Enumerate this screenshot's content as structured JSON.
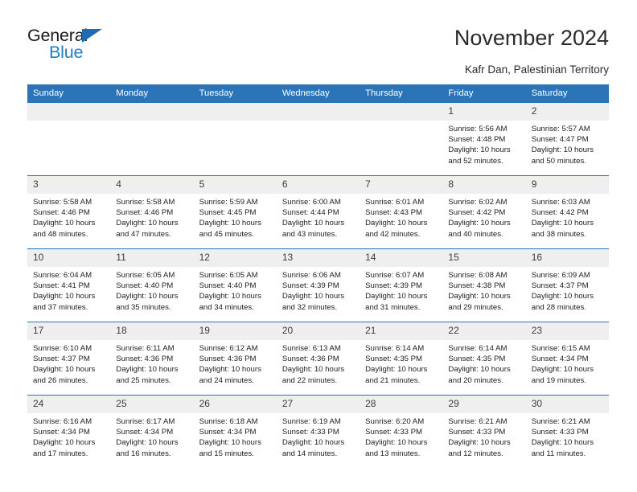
{
  "brand": {
    "name_top": "General",
    "name_bottom": "Blue",
    "accent_color": "#2c74b8"
  },
  "header": {
    "title": "November 2024",
    "subtitle": "Kafr Dan, Palestinian Territory"
  },
  "calendar": {
    "weekday_headers": [
      "Sunday",
      "Monday",
      "Tuesday",
      "Wednesday",
      "Thursday",
      "Friday",
      "Saturday"
    ],
    "labels": {
      "sunrise": "Sunrise:",
      "sunset": "Sunset:",
      "daylight": "Daylight:"
    },
    "weeks": [
      [
        {
          "day": "",
          "empty": true
        },
        {
          "day": "",
          "empty": true
        },
        {
          "day": "",
          "empty": true
        },
        {
          "day": "",
          "empty": true
        },
        {
          "day": "",
          "empty": true
        },
        {
          "day": "1",
          "sunrise": "Sunrise: 5:56 AM",
          "sunset": "Sunset: 4:48 PM",
          "daylight_1": "Daylight: 10 hours",
          "daylight_2": "and 52 minutes."
        },
        {
          "day": "2",
          "sunrise": "Sunrise: 5:57 AM",
          "sunset": "Sunset: 4:47 PM",
          "daylight_1": "Daylight: 10 hours",
          "daylight_2": "and 50 minutes."
        }
      ],
      [
        {
          "day": "3",
          "sunrise": "Sunrise: 5:58 AM",
          "sunset": "Sunset: 4:46 PM",
          "daylight_1": "Daylight: 10 hours",
          "daylight_2": "and 48 minutes."
        },
        {
          "day": "4",
          "sunrise": "Sunrise: 5:58 AM",
          "sunset": "Sunset: 4:46 PM",
          "daylight_1": "Daylight: 10 hours",
          "daylight_2": "and 47 minutes."
        },
        {
          "day": "5",
          "sunrise": "Sunrise: 5:59 AM",
          "sunset": "Sunset: 4:45 PM",
          "daylight_1": "Daylight: 10 hours",
          "daylight_2": "and 45 minutes."
        },
        {
          "day": "6",
          "sunrise": "Sunrise: 6:00 AM",
          "sunset": "Sunset: 4:44 PM",
          "daylight_1": "Daylight: 10 hours",
          "daylight_2": "and 43 minutes."
        },
        {
          "day": "7",
          "sunrise": "Sunrise: 6:01 AM",
          "sunset": "Sunset: 4:43 PM",
          "daylight_1": "Daylight: 10 hours",
          "daylight_2": "and 42 minutes."
        },
        {
          "day": "8",
          "sunrise": "Sunrise: 6:02 AM",
          "sunset": "Sunset: 4:42 PM",
          "daylight_1": "Daylight: 10 hours",
          "daylight_2": "and 40 minutes."
        },
        {
          "day": "9",
          "sunrise": "Sunrise: 6:03 AM",
          "sunset": "Sunset: 4:42 PM",
          "daylight_1": "Daylight: 10 hours",
          "daylight_2": "and 38 minutes."
        }
      ],
      [
        {
          "day": "10",
          "sunrise": "Sunrise: 6:04 AM",
          "sunset": "Sunset: 4:41 PM",
          "daylight_1": "Daylight: 10 hours",
          "daylight_2": "and 37 minutes."
        },
        {
          "day": "11",
          "sunrise": "Sunrise: 6:05 AM",
          "sunset": "Sunset: 4:40 PM",
          "daylight_1": "Daylight: 10 hours",
          "daylight_2": "and 35 minutes."
        },
        {
          "day": "12",
          "sunrise": "Sunrise: 6:05 AM",
          "sunset": "Sunset: 4:40 PM",
          "daylight_1": "Daylight: 10 hours",
          "daylight_2": "and 34 minutes."
        },
        {
          "day": "13",
          "sunrise": "Sunrise: 6:06 AM",
          "sunset": "Sunset: 4:39 PM",
          "daylight_1": "Daylight: 10 hours",
          "daylight_2": "and 32 minutes."
        },
        {
          "day": "14",
          "sunrise": "Sunrise: 6:07 AM",
          "sunset": "Sunset: 4:39 PM",
          "daylight_1": "Daylight: 10 hours",
          "daylight_2": "and 31 minutes."
        },
        {
          "day": "15",
          "sunrise": "Sunrise: 6:08 AM",
          "sunset": "Sunset: 4:38 PM",
          "daylight_1": "Daylight: 10 hours",
          "daylight_2": "and 29 minutes."
        },
        {
          "day": "16",
          "sunrise": "Sunrise: 6:09 AM",
          "sunset": "Sunset: 4:37 PM",
          "daylight_1": "Daylight: 10 hours",
          "daylight_2": "and 28 minutes."
        }
      ],
      [
        {
          "day": "17",
          "sunrise": "Sunrise: 6:10 AM",
          "sunset": "Sunset: 4:37 PM",
          "daylight_1": "Daylight: 10 hours",
          "daylight_2": "and 26 minutes."
        },
        {
          "day": "18",
          "sunrise": "Sunrise: 6:11 AM",
          "sunset": "Sunset: 4:36 PM",
          "daylight_1": "Daylight: 10 hours",
          "daylight_2": "and 25 minutes."
        },
        {
          "day": "19",
          "sunrise": "Sunrise: 6:12 AM",
          "sunset": "Sunset: 4:36 PM",
          "daylight_1": "Daylight: 10 hours",
          "daylight_2": "and 24 minutes."
        },
        {
          "day": "20",
          "sunrise": "Sunrise: 6:13 AM",
          "sunset": "Sunset: 4:36 PM",
          "daylight_1": "Daylight: 10 hours",
          "daylight_2": "and 22 minutes."
        },
        {
          "day": "21",
          "sunrise": "Sunrise: 6:14 AM",
          "sunset": "Sunset: 4:35 PM",
          "daylight_1": "Daylight: 10 hours",
          "daylight_2": "and 21 minutes."
        },
        {
          "day": "22",
          "sunrise": "Sunrise: 6:14 AM",
          "sunset": "Sunset: 4:35 PM",
          "daylight_1": "Daylight: 10 hours",
          "daylight_2": "and 20 minutes."
        },
        {
          "day": "23",
          "sunrise": "Sunrise: 6:15 AM",
          "sunset": "Sunset: 4:34 PM",
          "daylight_1": "Daylight: 10 hours",
          "daylight_2": "and 19 minutes."
        }
      ],
      [
        {
          "day": "24",
          "sunrise": "Sunrise: 6:16 AM",
          "sunset": "Sunset: 4:34 PM",
          "daylight_1": "Daylight: 10 hours",
          "daylight_2": "and 17 minutes."
        },
        {
          "day": "25",
          "sunrise": "Sunrise: 6:17 AM",
          "sunset": "Sunset: 4:34 PM",
          "daylight_1": "Daylight: 10 hours",
          "daylight_2": "and 16 minutes."
        },
        {
          "day": "26",
          "sunrise": "Sunrise: 6:18 AM",
          "sunset": "Sunset: 4:34 PM",
          "daylight_1": "Daylight: 10 hours",
          "daylight_2": "and 15 minutes."
        },
        {
          "day": "27",
          "sunrise": "Sunrise: 6:19 AM",
          "sunset": "Sunset: 4:33 PM",
          "daylight_1": "Daylight: 10 hours",
          "daylight_2": "and 14 minutes."
        },
        {
          "day": "28",
          "sunrise": "Sunrise: 6:20 AM",
          "sunset": "Sunset: 4:33 PM",
          "daylight_1": "Daylight: 10 hours",
          "daylight_2": "and 13 minutes."
        },
        {
          "day": "29",
          "sunrise": "Sunrise: 6:21 AM",
          "sunset": "Sunset: 4:33 PM",
          "daylight_1": "Daylight: 10 hours",
          "daylight_2": "and 12 minutes."
        },
        {
          "day": "30",
          "sunrise": "Sunrise: 6:21 AM",
          "sunset": "Sunset: 4:33 PM",
          "daylight_1": "Daylight: 10 hours",
          "daylight_2": "and 11 minutes."
        }
      ]
    ]
  }
}
